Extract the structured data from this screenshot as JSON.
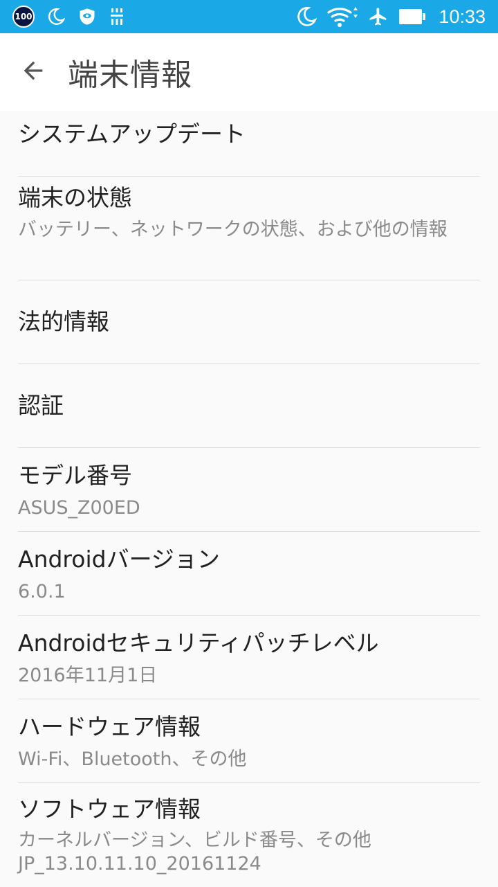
{
  "status_bar": {
    "battery_badge": "100",
    "left_icons": [
      "moon-icon",
      "shield-icon",
      "usb-debug-icon"
    ],
    "right_icons": [
      "moon-icon",
      "wifi-icon",
      "airplane-icon",
      "battery-icon"
    ],
    "time": "10:33",
    "background": "#1aa9e6"
  },
  "app_bar": {
    "back_icon": "arrow-left-icon",
    "title": "端末情報"
  },
  "items": [
    {
      "title": "システムアップデート",
      "summary": ""
    },
    {
      "title": "端末の状態",
      "summary": "バッテリー、ネットワークの状態、および他の情報"
    },
    {
      "title": "法的情報",
      "summary": ""
    },
    {
      "title": "認証",
      "summary": ""
    },
    {
      "title": "モデル番号",
      "summary": "ASUS_Z00ED"
    },
    {
      "title": "Androidバージョン",
      "summary": "6.0.1"
    },
    {
      "title": "Androidセキュリティパッチレベル",
      "summary": "2016年11月1日"
    },
    {
      "title": "ハードウェア情報",
      "summary": "Wi-Fi、Bluetooth、その他"
    },
    {
      "title": "ソフトウェア情報",
      "summary": "カーネルバージョン、ビルド番号、その他",
      "summary2": "JP_13.10.11.10_20161124"
    }
  ]
}
